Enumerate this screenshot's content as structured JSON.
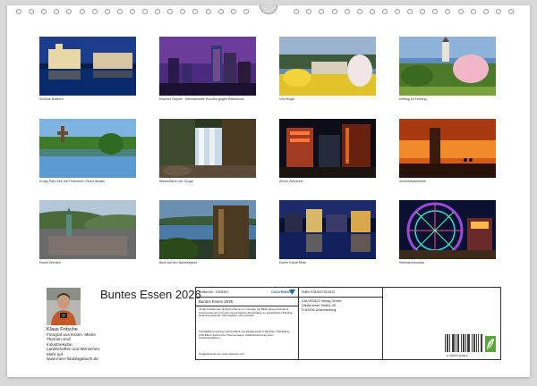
{
  "calendar": {
    "title": "Buntes Essen 2026",
    "photos": [
      {
        "caption": "Schloss Borbeck",
        "theme": "castle-night"
      },
      {
        "caption": "Essener Skyline - Internationale Wochen gegen Rassismus",
        "theme": "skyline-purple"
      },
      {
        "caption": "Villa Hügel",
        "theme": "villa-spring"
      },
      {
        "caption": "Kettwig im Frühling",
        "theme": "church-blossom"
      },
      {
        "caption": "Krupp-Park-See mit Förderturm Zeche Amalie",
        "theme": "lake-park"
      },
      {
        "caption": "Wasserfall in der Gruga",
        "theme": "waterfall"
      },
      {
        "caption": "Zeche Zollverein",
        "theme": "zollverein-night"
      },
      {
        "caption": "Schurenbachhalde",
        "theme": "slab-sunset"
      },
      {
        "caption": "Essen-Werden",
        "theme": "town-hills"
      },
      {
        "caption": "Blick auf den Baldeneysee",
        "theme": "lake-view"
      },
      {
        "caption": "Essen Grüne Mitte",
        "theme": "city-night-water"
      },
      {
        "caption": "Weihnachtsmarkt",
        "theme": "ferris-wheel"
      }
    ]
  },
  "author": {
    "name": "Klaus Fritsche",
    "bio_lines": [
      "Fotograf aus Essen. Meine",
      "Themen sind",
      "Industriekultur,",
      "Landschaften und Menschen.",
      "Mehr auf",
      "www.mein-fotoblogebuch.de"
    ]
  },
  "info_box": {
    "article_no": "Artikel-Nr.: 2005367",
    "publisher_logo": "CALVENDO",
    "title": "Buntes Essen 2026",
    "notice": "Infolge bestehender Schutzrechte ist es untersagt, die Bilder dieses Kalenders herauszutrennen und ohne Genehmigung des Verlages zu gewerblichen Zwecken weiterzuverwenden. Alle Angaben ohne Gewähr.",
    "production": "CALVENDO produziert fortschrittlich und klimabewusst in DE & EU. Plastikfreie CO2-Bilanz dank kurzer Transportwege. Abfall-Reduzierung beim Kreislaufverfahren.",
    "contact": "info@calvendo.com   www.calvendo.com",
    "isbn": "ISBN 9783457912812",
    "publisher": [
      "CALVENDO Verlag GmbH",
      "Ottobrunner Straße 39",
      "D-82008 Unterhaching"
    ],
    "barcode_digits": "9 783457 912812"
  },
  "colors": {
    "page": "#ffffff",
    "background": "#d9d9d9",
    "border": "#333333"
  }
}
